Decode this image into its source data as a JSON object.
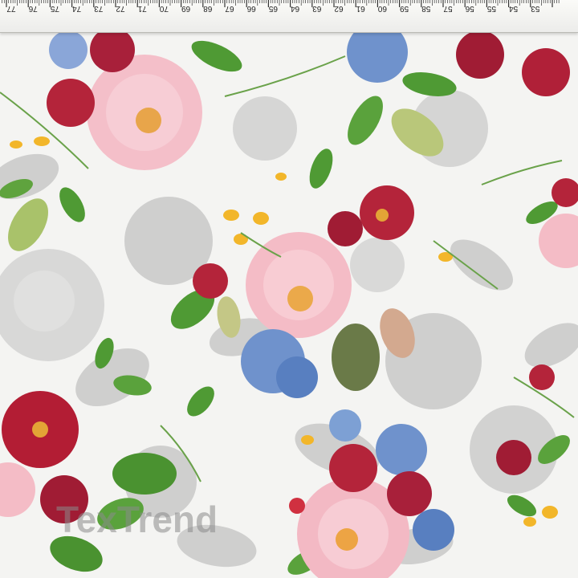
{
  "ruler": {
    "numbers": [
      "77",
      "76",
      "75",
      "74",
      "73",
      "72",
      "71",
      "70",
      "69",
      "68",
      "67",
      "66",
      "65",
      "64",
      "63",
      "62",
      "61",
      "60",
      "59",
      "58",
      "57",
      "56",
      "55",
      "54",
      "53"
    ]
  },
  "watermark": {
    "text": "TexTrend",
    "color": "#8a8a8a"
  },
  "palette": {
    "background": "#f4f4f2",
    "pink_rose": "#f3b8c4",
    "red_flower": "#b4243a",
    "blue_flower": "#6f92cc",
    "leaf": "#5a9b3a",
    "grey_shadow": "#c6c6c6",
    "yellow_bud": "#f2b62a"
  }
}
